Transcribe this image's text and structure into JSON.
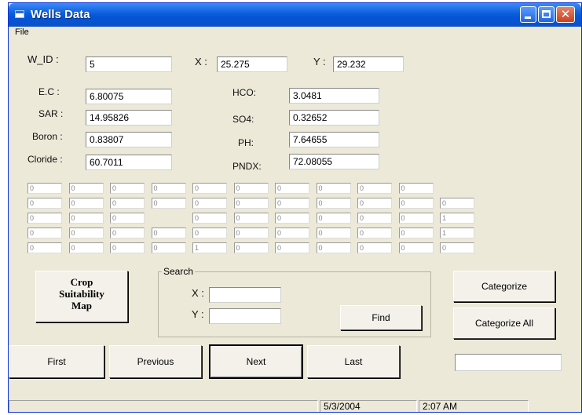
{
  "window": {
    "title": "Wells Data"
  },
  "menu": {
    "file": "File"
  },
  "header": {
    "w_id_label": "W_ID :",
    "w_id_value": "5",
    "x_label": "X :",
    "x_value": "25.275",
    "y_label": "Y :",
    "y_value": "29.232"
  },
  "params": {
    "ec_label": "E.C :",
    "ec_value": "6.80075",
    "sar_label": "SAR :",
    "sar_value": "14.95826",
    "boron_label": "Boron :",
    "boron_value": "0.83807",
    "cloride_label": "Cloride :",
    "cloride_value": "60.7011",
    "hco_label": "HCO:",
    "hco_value": "3.0481",
    "so4_label": "SO4:",
    "so4_value": "0.32652",
    "ph_label": "PH:",
    "ph_value": "7.64655",
    "pndx_label": "PNDX:",
    "pndx_value": "72.08055"
  },
  "grid": {
    "rows": [
      [
        "0",
        "0",
        "0",
        "0",
        "0",
        "0",
        "0",
        "0",
        "0",
        "0",
        null
      ],
      [
        "0",
        "0",
        "0",
        "0",
        "0",
        "0",
        "0",
        "0",
        "0",
        "0",
        "0"
      ],
      [
        "0",
        "0",
        "0",
        null,
        "0",
        "0",
        "0",
        "0",
        "0",
        "0",
        "1"
      ],
      [
        "0",
        "0",
        "0",
        "0",
        "0",
        "0",
        "0",
        "0",
        "0",
        "0",
        "1"
      ],
      [
        "0",
        "0",
        "0",
        "0",
        "1",
        "0",
        "0",
        "0",
        "0",
        "0",
        "0"
      ]
    ]
  },
  "buttons": {
    "crop_line1": "Crop",
    "crop_line2": "Suitability",
    "crop_line3": "Map",
    "categorize": "Categorize",
    "categorize_all": "Categorize All",
    "find": "Find",
    "first": "First",
    "previous": "Previous",
    "next": "Next",
    "last": "Last"
  },
  "search": {
    "legend": "Search",
    "x_label": "X :",
    "x_value": "",
    "y_label": "Y :",
    "y_value": ""
  },
  "result_box": {
    "value": ""
  },
  "status": {
    "date": "5/3/2004",
    "time": "2:07 AM"
  }
}
